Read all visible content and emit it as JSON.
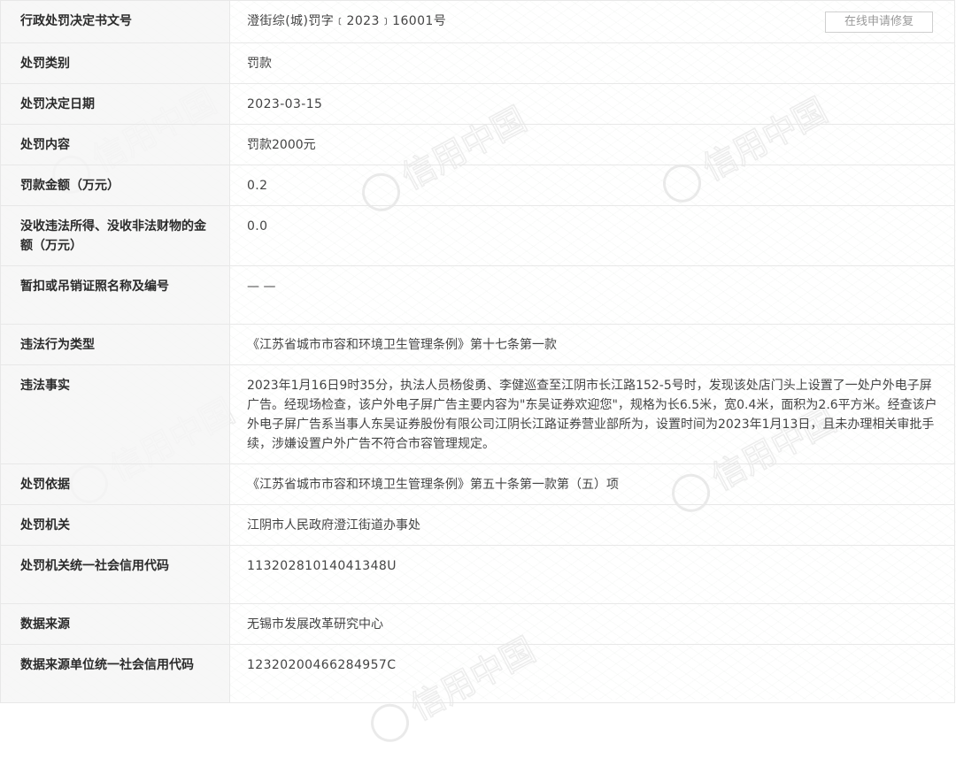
{
  "watermark_text": "信用中国",
  "repair_button_label": "在线申请修复",
  "rows": [
    {
      "label": "行政处罚决定书文号",
      "value": "澄街综(城)罚字﹝2023﹞16001号"
    },
    {
      "label": "处罚类别",
      "value": "罚款"
    },
    {
      "label": "处罚决定日期",
      "value": "2023-03-15"
    },
    {
      "label": "处罚内容",
      "value": "罚款2000元"
    },
    {
      "label": "罚款金额（万元）",
      "value": "0.2"
    },
    {
      "label": "没收违法所得、没收非法财物的金额（万元）",
      "value": "0.0"
    },
    {
      "label": "暂扣或吊销证照名称及编号",
      "value": "— —"
    },
    {
      "label": "违法行为类型",
      "value": "《江苏省城市市容和环境卫生管理条例》第十七条第一款"
    },
    {
      "label": "违法事实",
      "value": "2023年1月16日9时35分，执法人员杨俊勇、李健巡查至江阴市长江路152-5号时，发现该处店门头上设置了一处户外电子屏广告。经现场检查，该户外电子屏广告主要内容为\"东吴证券欢迎您\"，规格为长6.5米，宽0.4米，面积为2.6平方米。经查该户外电子屏广告系当事人东吴证券股份有限公司江阴长江路证券营业部所为，设置时间为2023年1月13日，且未办理相关审批手续，涉嫌设置户外广告不符合市容管理规定。"
    },
    {
      "label": "处罚依据",
      "value": "《江苏省城市市容和环境卫生管理条例》第五十条第一款第（五）项"
    },
    {
      "label": "处罚机关",
      "value": "江阴市人民政府澄江街道办事处"
    },
    {
      "label": "处罚机关统一社会信用代码",
      "value": "11320281014041348U"
    },
    {
      "label": "数据来源",
      "value": "无锡市发展改革研究中心"
    },
    {
      "label": "数据来源单位统一社会信用代码",
      "value": "12320200466284957C"
    }
  ]
}
